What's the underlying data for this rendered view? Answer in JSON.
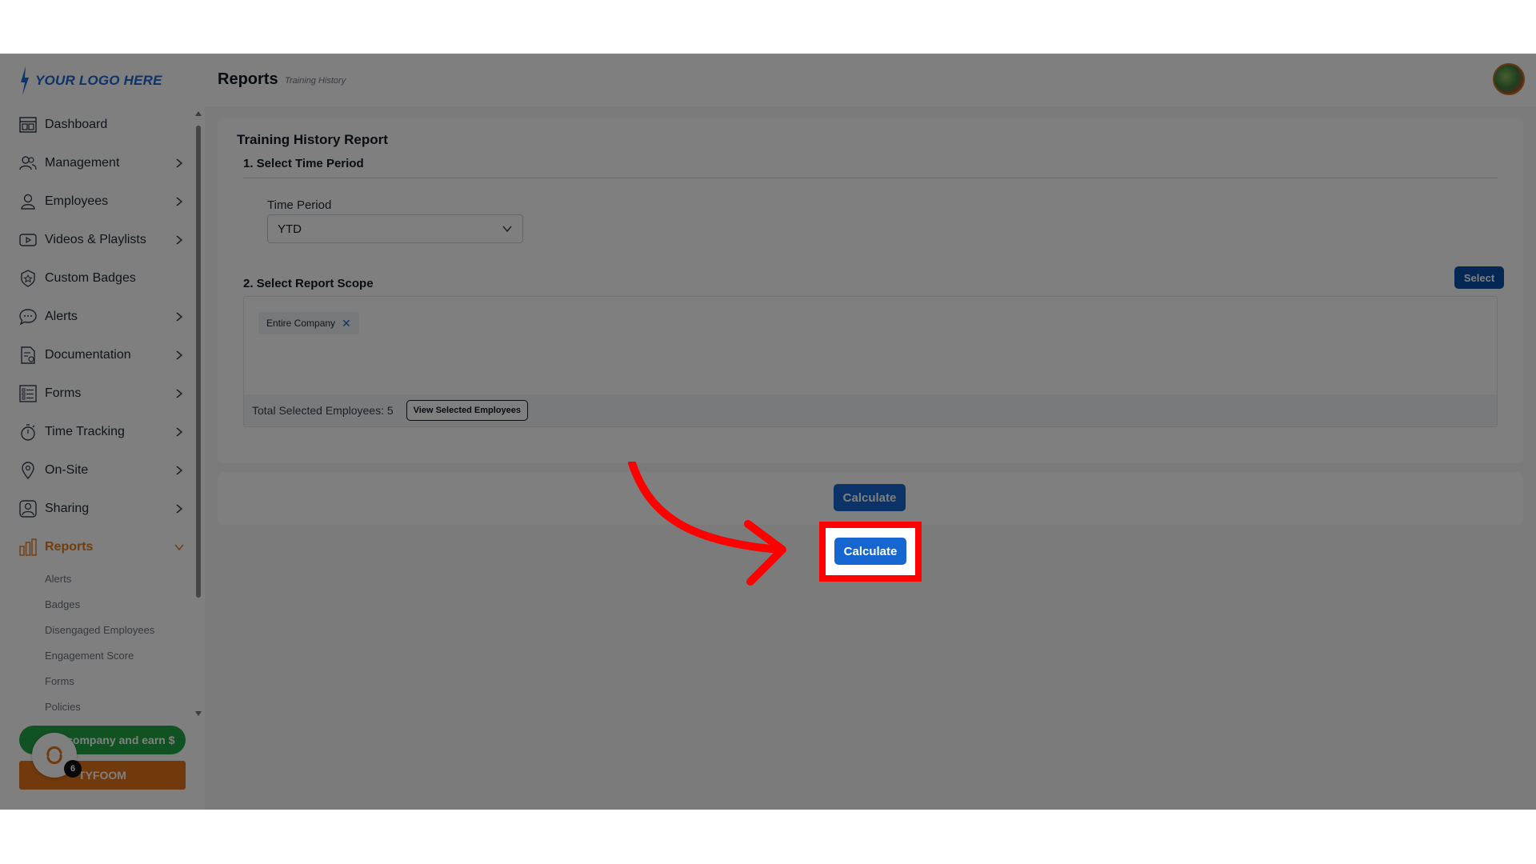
{
  "logo": {
    "text": "YOUR LOGO HERE"
  },
  "header": {
    "title": "Reports",
    "breadcrumb": "Training History"
  },
  "sidebar": {
    "items": [
      {
        "label": "Dashboard",
        "icon": "dashboard-icon",
        "has_chevron": false
      },
      {
        "label": "Management",
        "icon": "people-icon",
        "has_chevron": true
      },
      {
        "label": "Employees",
        "icon": "user-icon",
        "has_chevron": true
      },
      {
        "label": "Videos & Playlists",
        "icon": "play-icon",
        "has_chevron": true
      },
      {
        "label": "Custom Badges",
        "icon": "badge-icon",
        "has_chevron": false
      },
      {
        "label": "Alerts",
        "icon": "chat-icon",
        "has_chevron": true
      },
      {
        "label": "Documentation",
        "icon": "document-icon",
        "has_chevron": true
      },
      {
        "label": "Forms",
        "icon": "form-icon",
        "has_chevron": true
      },
      {
        "label": "Time Tracking",
        "icon": "stopwatch-icon",
        "has_chevron": true
      },
      {
        "label": "On-Site",
        "icon": "pin-icon",
        "has_chevron": true
      },
      {
        "label": "Sharing",
        "icon": "share-user-icon",
        "has_chevron": true
      },
      {
        "label": "Reports",
        "icon": "bar-chart-icon",
        "has_chevron": true,
        "active": true
      }
    ],
    "reports_sub": [
      "Alerts",
      "Badges",
      "Disengaged Employees",
      "Engagement Score",
      "Forms",
      "Policies"
    ],
    "refer_label": "R... company and earn $",
    "tyfoom_label": "TYFOOM",
    "launcher_badge": "6"
  },
  "report": {
    "title": "Training History Report",
    "section1": "1. Select Time Period",
    "time_period_label": "Time Period",
    "time_period_value": "YTD",
    "section2": "2. Select Report Scope",
    "select_button": "Select",
    "chip_label": "Entire Company",
    "total_text": "Total Selected Employees: 5",
    "view_button": "View Selected Employees",
    "calculate_button": "Calculate"
  },
  "colors": {
    "accent_orange": "#e07a1f",
    "primary_blue": "#1666d1",
    "highlight_red": "#ff0000"
  }
}
